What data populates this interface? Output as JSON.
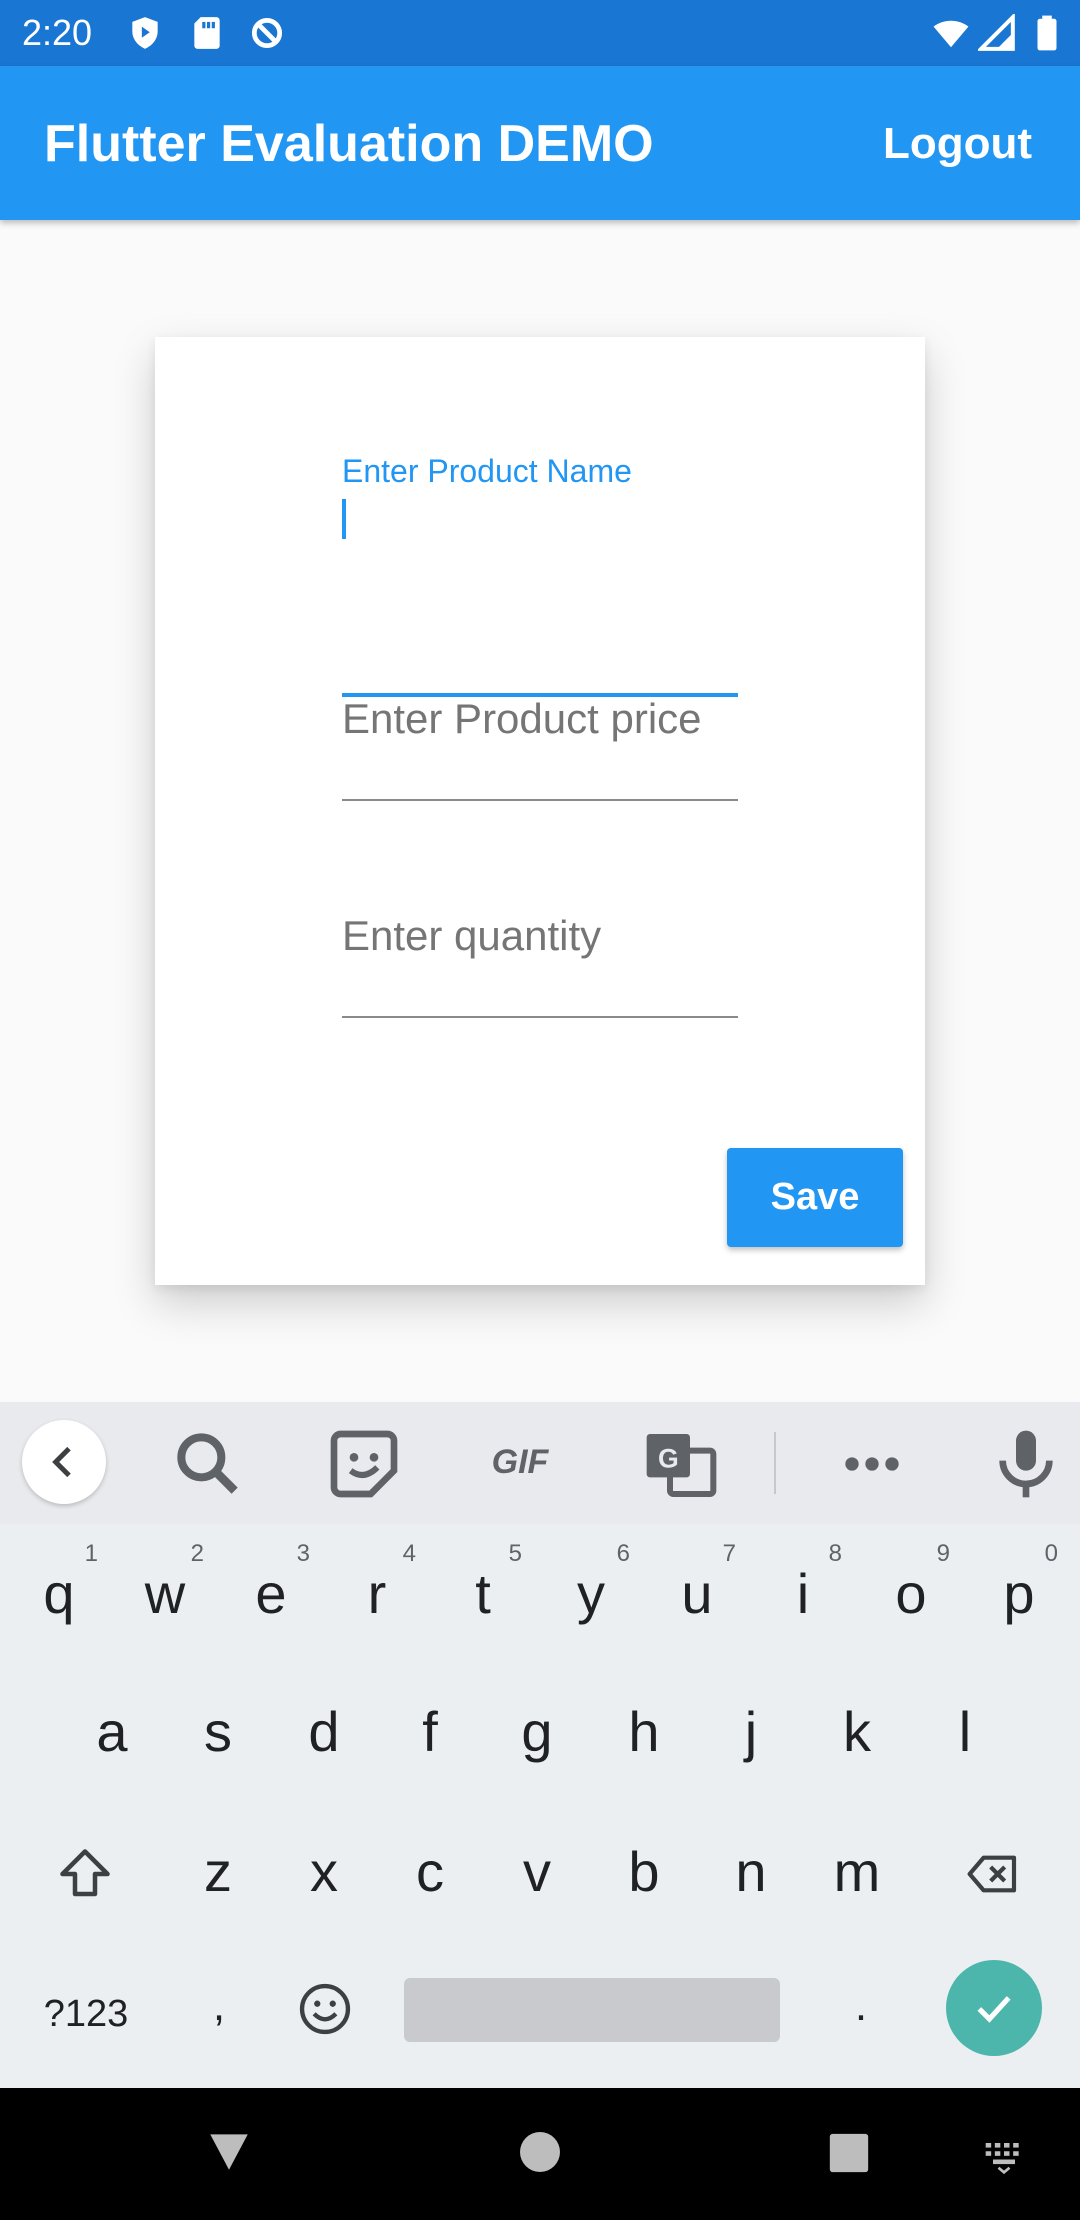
{
  "status_bar": {
    "time": "2:20"
  },
  "app_bar": {
    "title": "Flutter Evaluation DEMO",
    "logout_label": "Logout"
  },
  "form": {
    "product_name": {
      "label": "Enter Product Name",
      "value": ""
    },
    "product_price": {
      "placeholder": "Enter Product price"
    },
    "quantity": {
      "placeholder": "Enter quantity"
    },
    "save_label": "Save"
  },
  "keyboard": {
    "toolbar": {
      "gif_label": "GIF"
    },
    "row1": [
      {
        "k": "q",
        "s": "1"
      },
      {
        "k": "w",
        "s": "2"
      },
      {
        "k": "e",
        "s": "3"
      },
      {
        "k": "r",
        "s": "4"
      },
      {
        "k": "t",
        "s": "5"
      },
      {
        "k": "y",
        "s": "6"
      },
      {
        "k": "u",
        "s": "7"
      },
      {
        "k": "i",
        "s": "8"
      },
      {
        "k": "o",
        "s": "9"
      },
      {
        "k": "p",
        "s": "0"
      }
    ],
    "row2": [
      "a",
      "s",
      "d",
      "f",
      "g",
      "h",
      "j",
      "k",
      "l"
    ],
    "row3": [
      "z",
      "x",
      "c",
      "v",
      "b",
      "n",
      "m"
    ],
    "symbols_label": "?123",
    "comma": ",",
    "period": "."
  },
  "colors": {
    "primary": "#2196f3",
    "status_bar": "#1976d2",
    "enter_key": "#4db6ac"
  }
}
